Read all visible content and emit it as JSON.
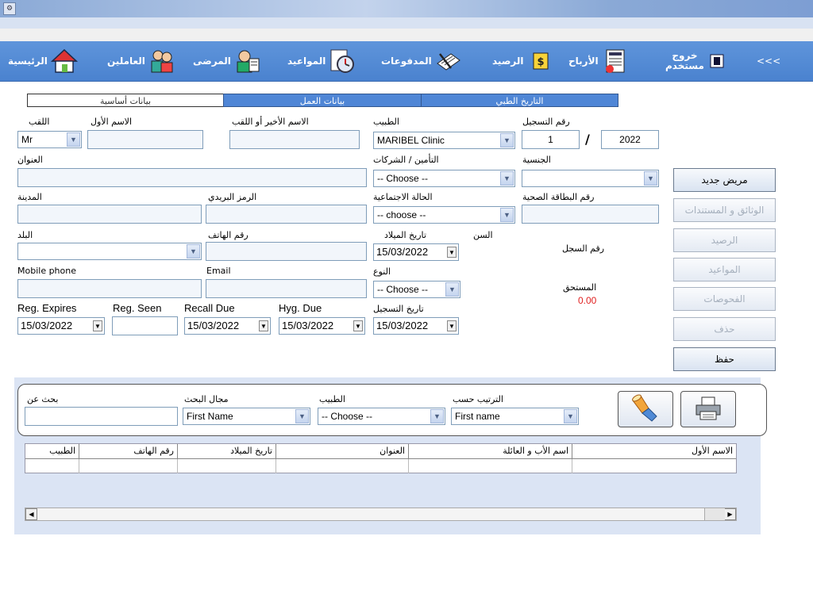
{
  "titlebar": {
    "icon": "app-icon"
  },
  "nav": {
    "items": [
      {
        "label": "الرئيسية",
        "icon": "home-icon"
      },
      {
        "label": "العاملين",
        "icon": "staff-icon"
      },
      {
        "label": "المرضى",
        "icon": "patients-icon"
      },
      {
        "label": "المواعيد",
        "icon": "clock-icon"
      },
      {
        "label": "المدفوعات",
        "icon": "payments-icon"
      },
      {
        "label": "الرصيد",
        "icon": "balance-icon"
      },
      {
        "label": "الأرباح",
        "icon": "profits-icon"
      },
      {
        "label_line1": "خروج",
        "label_line2": "مستخدم",
        "icon": "logout-icon"
      },
      {
        "label": "<<<",
        "icon": "more-icon"
      }
    ]
  },
  "tabs": [
    {
      "label": "بيانات أساسية"
    },
    {
      "label": "بيانات العمل"
    },
    {
      "label": "التاريخ الطبي"
    }
  ],
  "form": {
    "title_label": "اللقب",
    "title_value": "Mr",
    "first_name_label": "الاسم الأول",
    "last_name_label": "الاسم الأخير أو اللقب",
    "doctor_label": "الطبيب",
    "doctor_value": "MARIBEL Clinic",
    "reg_number_label": "رقم التسجيل",
    "reg_number_value": "1",
    "reg_year_value": "2022",
    "reg_separator": "/",
    "address_label": "العنوان",
    "insurance_label": "التأمين / الشركات",
    "insurance_value": "-- Choose --",
    "nationality_label": "الجنسية",
    "city_label": "المدينة",
    "postal_label": "الرمز البريدي",
    "marital_label": "الحالة الاجتماعية",
    "marital_value": "-- choose --",
    "health_card_label": "رقم البطاقة الصحية",
    "country_label": "البلد",
    "phone_label": "رقم الهاتف",
    "birth_date_label": "تاريخ الميلاد",
    "birth_date_value": "15/03/2022",
    "age_label": "السن",
    "record_number_label": "رقم السجل",
    "mobile_label": "Mobile phone",
    "email_label": "Email",
    "gender_label": "النوع",
    "gender_value": "-- Choose --",
    "due_label": "المستحق",
    "due_value": "0.00",
    "reg_expires_label": "Reg. Expires",
    "reg_expires_value": "15/03/2022",
    "reg_seen_label": "Reg. Seen",
    "recall_due_label": "Recall Due",
    "recall_due_value": "15/03/2022",
    "hyg_due_label": "Hyg. Due",
    "hyg_due_value": "15/03/2022",
    "reg_date_label": "تاريخ التسجيل",
    "reg_date_value": "15/03/2022"
  },
  "buttons": {
    "new_patient": "مريض جديد",
    "documents": "الوثائق و المستندات",
    "balance": "الرصيد",
    "appointments": "المواعيد",
    "exams": "الفحوصات",
    "delete": "حذف",
    "save": "حفظ"
  },
  "search": {
    "search_for_label": "بحث عن",
    "search_field_label": "مجال البحث",
    "search_field_value": "First Name",
    "doctor_label": "الطبيب",
    "doctor_value": "-- Choose --",
    "sort_label": "الترتيب حسب",
    "sort_value": "First name",
    "search_button_icon": "flashlight-icon",
    "print_button_icon": "printer-icon"
  },
  "grid": {
    "columns": [
      "الاسم الأول",
      "اسم الأب و العائلة",
      "العنوان",
      "تاريخ الميلاد",
      "رقم الهاتف",
      "الطبيب"
    ]
  },
  "colors": {
    "nav_bg": "#4a82cf",
    "tab_bg": "#4f86d6",
    "due": "#e02020"
  }
}
